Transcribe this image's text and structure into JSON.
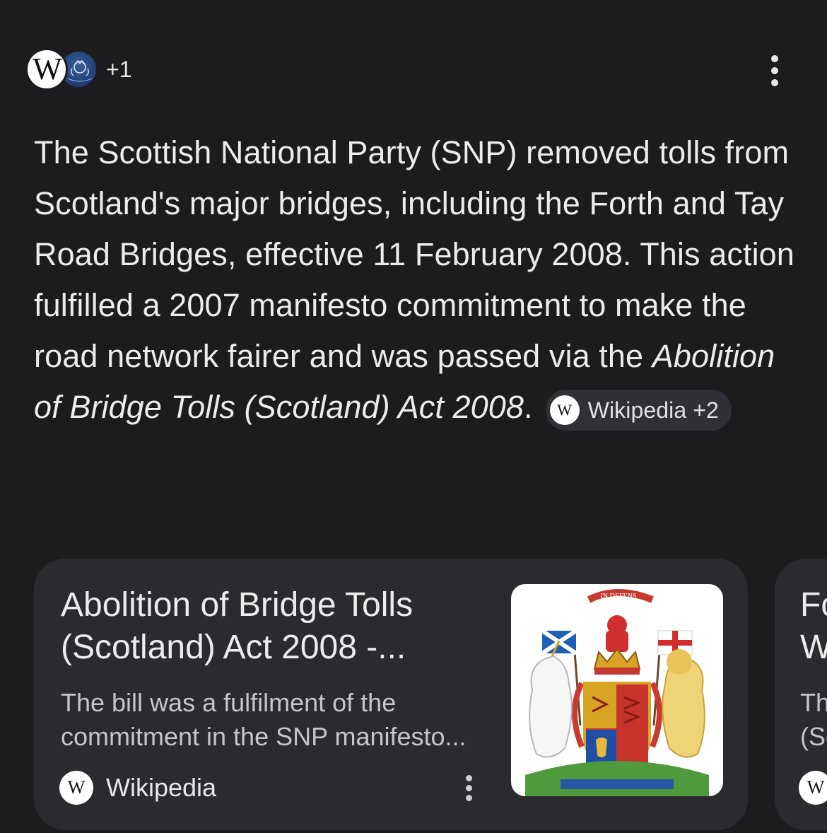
{
  "sources_header": {
    "favicons": [
      "wikipedia-favicon",
      "uk-legislation-favicon"
    ],
    "extra_count": "+1"
  },
  "answer": {
    "text_before_italic": "The Scottish National Party (SNP) removed tolls from Scotland's major bridges, including the Forth and Tay Road Bridges, effective 11 February 2008. This action fulfilled a 2007 manifesto commitment to make the road network fairer and was passed via the ",
    "italic_text": "Abolition of Bridge Tolls (Scotland) Act 2008",
    "text_after_italic": ".",
    "citation_chip": {
      "icon": "wikipedia-icon",
      "label": "Wikipedia +2"
    }
  },
  "cards": [
    {
      "title": "Abolition of Bridge Tolls\n(Scotland) Act 2008 -...",
      "snippet": "The bill was a fulfilment of the\ncommitment in the SNP manifesto...",
      "source_icon": "wikipedia-icon",
      "source_name": "Wikipedia",
      "thumbnail": "royal-coat-of-arms-scotland",
      "thumbnail_motto": "IN DEFENS"
    },
    {
      "title": "Fo\nW",
      "snippet": "Th\n(Sc",
      "source_icon": "wikipedia-icon",
      "source_name": ""
    }
  ],
  "colors": {
    "background": "#1c1c1f",
    "card_background": "#2a2a2f",
    "chip_background": "#303036",
    "text_primary": "#ececee",
    "text_secondary": "#c5c5ca"
  }
}
